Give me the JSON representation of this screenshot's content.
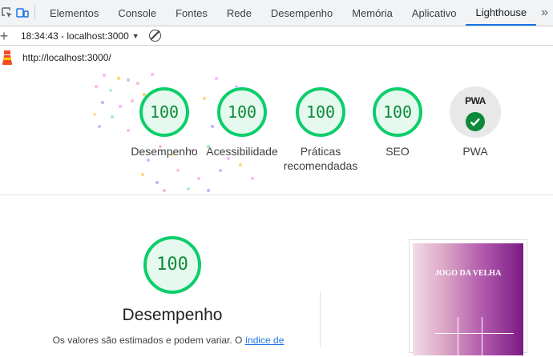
{
  "devtools": {
    "tabs": [
      "Elementos",
      "Console",
      "Fontes",
      "Rede",
      "Desempenho",
      "Memória",
      "Aplicativo",
      "Lighthouse"
    ],
    "active_tab": "Lighthouse",
    "more_label": "»"
  },
  "toolbar": {
    "report_label": "18:34:43 - localhost:3000"
  },
  "url": "http://localhost:3000/",
  "gauges": [
    {
      "score": "100",
      "label": "Desempenho"
    },
    {
      "score": "100",
      "label": "Acessibilidade"
    },
    {
      "score": "100",
      "label": "Práticas recomendadas"
    },
    {
      "score": "100",
      "label": "SEO"
    }
  ],
  "pwa": {
    "badge": "PWA",
    "label": "PWA"
  },
  "performance": {
    "score": "100",
    "title": "Desempenho",
    "note": "Os valores são estimados e podem variar. O ",
    "note_link": "índice de"
  },
  "screenshot": {
    "title": "JOGO DA VELHA"
  },
  "colors": {
    "pass": "#0cce6b",
    "pass_text": "#0c8a39",
    "link": "#1a73e8",
    "active_tab": "#1a73e8"
  }
}
